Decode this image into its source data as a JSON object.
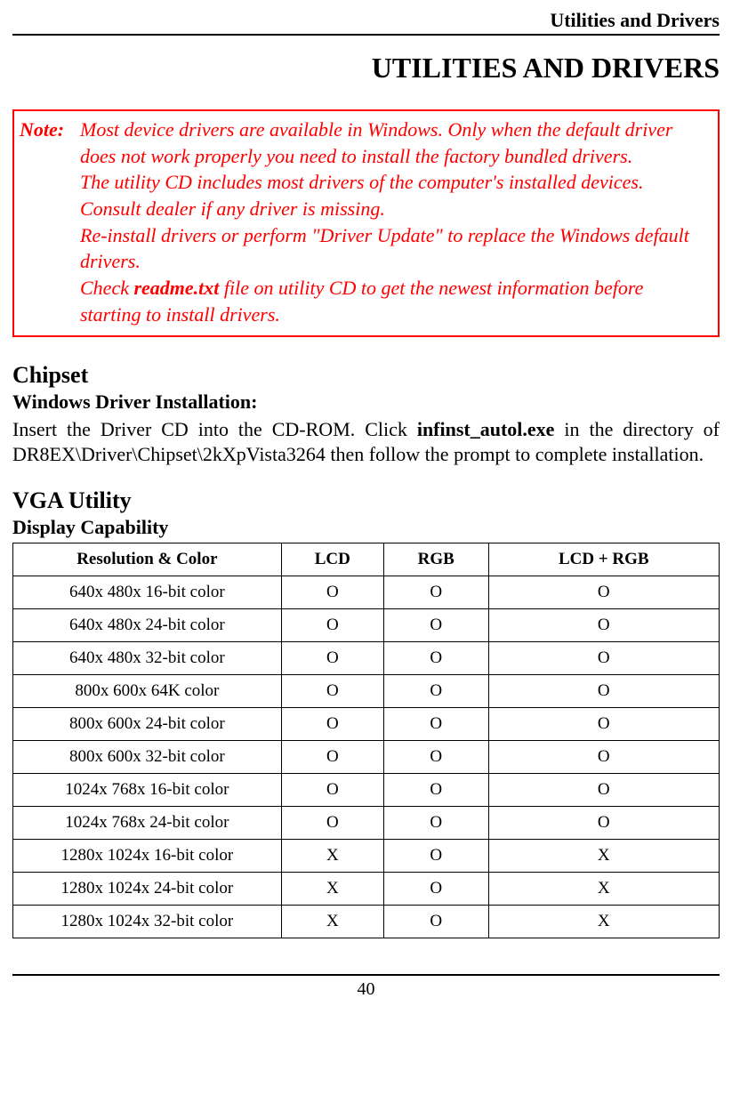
{
  "header": "Utilities and Drivers",
  "title": "UTILITIES AND DRIVERS",
  "note": {
    "label": "Note:",
    "p1": "Most device drivers are available in Windows. Only when the default driver does not work properly you need to install the factory bundled drivers.",
    "p2": "The utility CD includes most drivers of the computer's installed devices. Consult dealer if any driver is missing.",
    "p3": "Re-install drivers or perform \"Driver Update\" to replace the Windows default drivers.",
    "p4a": "Check ",
    "p4_readme": "readme.txt",
    "p4b": " file on utility CD to get the newest information before starting to install drivers."
  },
  "chipset": {
    "heading": "Chipset",
    "sub": "Windows Driver Installation:",
    "text_a": "Insert the Driver CD into the CD-ROM. Click ",
    "text_bold": "infinst_autol.exe",
    "text_b": " in the directory of DR8EX\\Driver\\Chipset\\2kXpVista3264 then follow the prompt to complete installation."
  },
  "vga": {
    "heading": "VGA Utility",
    "sub": "Display Capability",
    "columns": [
      "Resolution & Color",
      "LCD",
      "RGB",
      "LCD + RGB"
    ],
    "rows": [
      [
        "640x 480x 16-bit color",
        "O",
        "O",
        "O"
      ],
      [
        "640x 480x 24-bit color",
        "O",
        "O",
        "O"
      ],
      [
        "640x 480x 32-bit color",
        "O",
        "O",
        "O"
      ],
      [
        "800x 600x 64K color",
        "O",
        "O",
        "O"
      ],
      [
        "800x 600x 24-bit color",
        "O",
        "O",
        "O"
      ],
      [
        "800x 600x 32-bit color",
        "O",
        "O",
        "O"
      ],
      [
        "1024x 768x 16-bit color",
        "O",
        "O",
        "O"
      ],
      [
        "1024x 768x 24-bit color",
        "O",
        "O",
        "O"
      ],
      [
        "1280x 1024x 16-bit color",
        "X",
        "O",
        "X"
      ],
      [
        "1280x 1024x 24-bit color",
        "X",
        "O",
        "X"
      ],
      [
        "1280x 1024x 32-bit color",
        "X",
        "O",
        "X"
      ]
    ]
  },
  "page_number": "40"
}
